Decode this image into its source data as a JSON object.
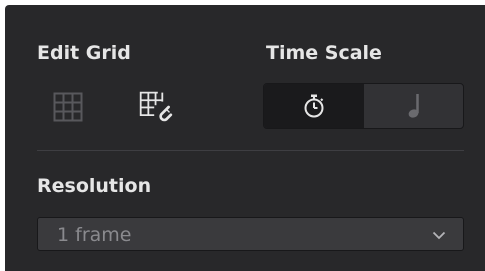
{
  "edit_grid": {
    "heading": "Edit Grid",
    "buttons": [
      {
        "icon": "grid-icon",
        "selected": false
      },
      {
        "icon": "grid-magnet-icon",
        "selected": true
      }
    ]
  },
  "time_scale": {
    "heading": "Time Scale",
    "options": [
      {
        "icon": "stopwatch-icon",
        "selected": true
      },
      {
        "icon": "quarter-note-icon",
        "selected": false
      }
    ]
  },
  "resolution": {
    "heading": "Resolution",
    "selected_value": "1 frame",
    "chevron_icon": "chevron-down-icon"
  },
  "colors": {
    "panel_bg": "#28282a",
    "text": "#e6e6e6",
    "muted_text": "#8a8a8e",
    "dim_icon": "#58585c"
  }
}
